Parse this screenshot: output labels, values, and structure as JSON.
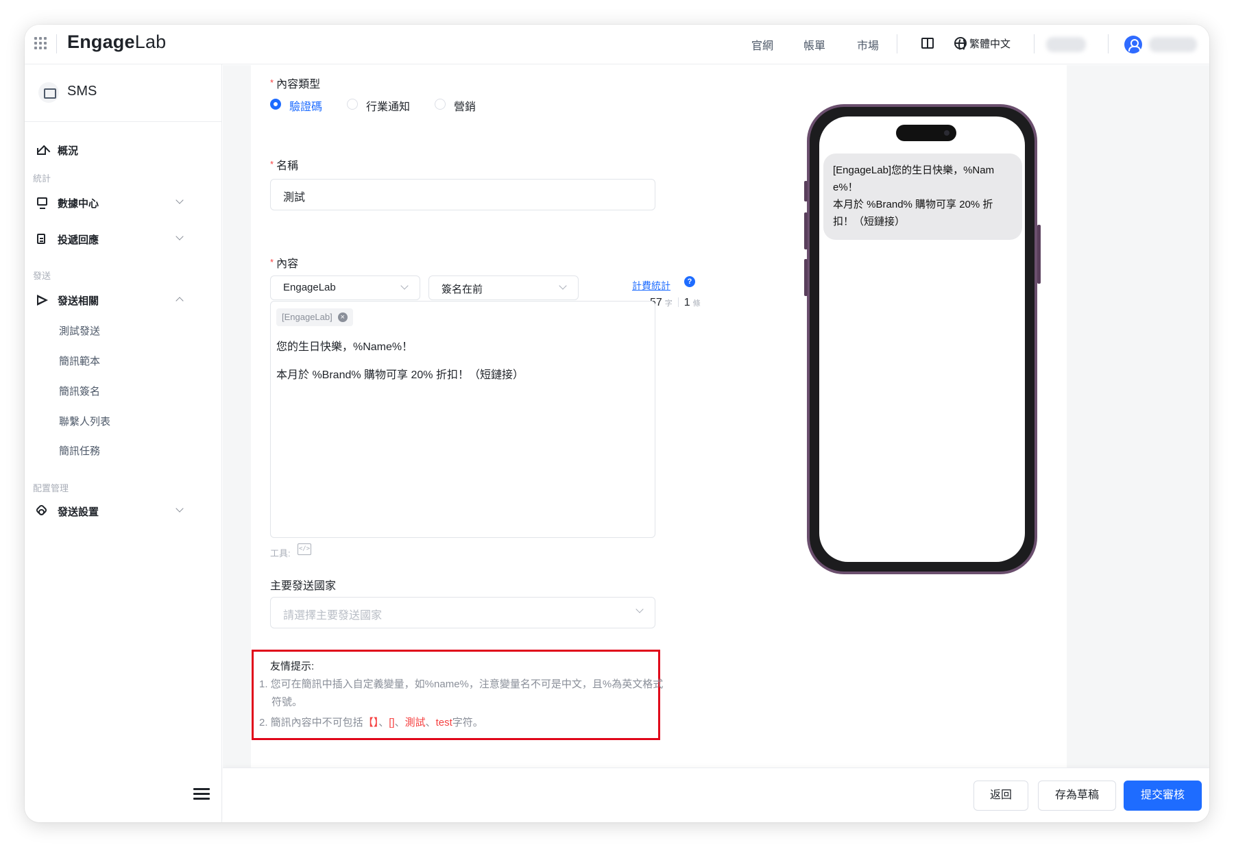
{
  "topbar": {
    "logo_prefix": "Engage",
    "logo_suffix": "Lab",
    "links": [
      "官網",
      "帳單",
      "市場"
    ],
    "language": "繁體中文",
    "colors": {
      "accent": "#1e6cff"
    }
  },
  "sidebar": {
    "product": "SMS",
    "overview": "概況",
    "sections": {
      "stats": "統計",
      "send": "發送",
      "config": "配置管理"
    },
    "items": {
      "data_center": "數據中心",
      "delivery_response": "投遞回應",
      "send_related": "發送相關",
      "send_settings": "發送設置"
    },
    "sub_items": [
      "測試發送",
      "簡訊範本",
      "簡訊簽名",
      "聯繫人列表",
      "簡訊任務"
    ]
  },
  "form": {
    "content_type_label": "內容類型",
    "content_types": [
      "驗證碼",
      "行業通知",
      "營銷"
    ],
    "selected_content_type": "驗證碼",
    "name_label": "名稱",
    "name_value": "測試",
    "content_label": "內容",
    "signature_select": "EngageLab",
    "signature_position_select": "簽名在前",
    "billing_link": "計費統計",
    "char_count": "57",
    "char_unit": "字",
    "message_count": "1",
    "message_unit": "條",
    "signature_tag": "[EngageLab]",
    "content_line1": "您的生日快樂，%Name%！",
    "content_line2": "本月於 %Brand% 購物可享 20% 折扣！（短鏈接）",
    "tools_label": "工具:",
    "country_label": "主要發送國家",
    "country_placeholder": "請選擇主要發送國家"
  },
  "tips": {
    "title": "友情提示:",
    "line1": "1. 您可在簡訊中插入自定義變量，如%name%，注意變量名不可是中文，且%為英文格式",
    "line1_cont": "符號。",
    "line2_prefix": "2. 簡訊內容中不可包括",
    "line2_red1": "【】",
    "line2_sep1": "、",
    "line2_red2": "[]",
    "line2_sep2": "、",
    "line2_red3": "測試",
    "line2_sep3": "、",
    "line2_red4": "test",
    "line2_suffix": "字符。"
  },
  "preview": {
    "message": "[EngageLab]您的生日快樂，%Name%！\n本月於 %Brand% 購物可享 20% 折扣！（短鏈接）"
  },
  "footer": {
    "back": "返回",
    "save_draft": "存為草稿",
    "submit": "提交審核"
  }
}
